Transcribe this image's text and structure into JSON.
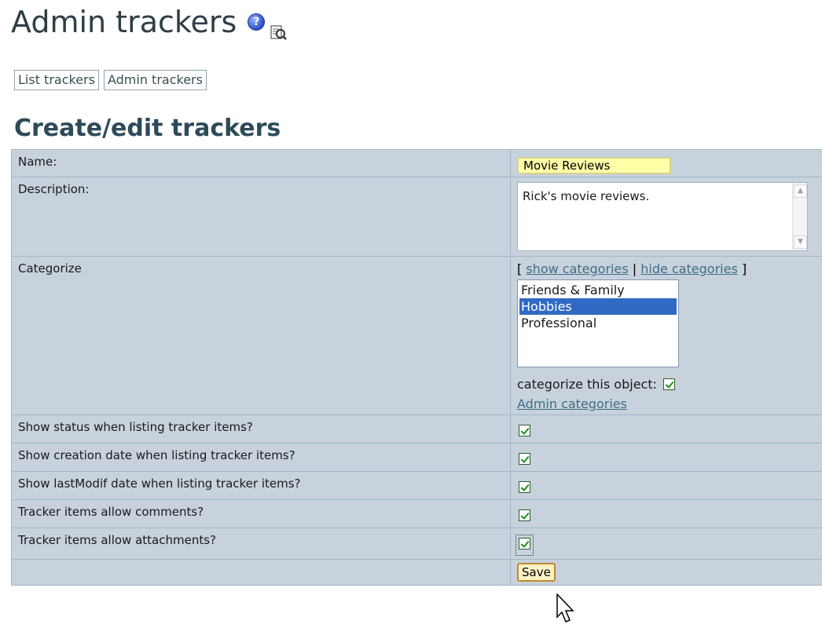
{
  "page": {
    "title": "Admin trackers",
    "help_icon": "help-icon",
    "edit_icon": "edit-icon"
  },
  "nav": {
    "buttons": [
      "List trackers",
      "Admin trackers"
    ]
  },
  "form": {
    "section_title": "Create/edit trackers",
    "name_label": "Name:",
    "name_value": "Movie Reviews",
    "description_label": "Description:",
    "description_value": "Rick's movie reviews.",
    "categorize_label": "Categorize",
    "cat_links": {
      "open_bracket": "[",
      "show": "show categories",
      "separator": "|",
      "hide": "hide categories",
      "close_bracket": "]"
    },
    "categories": [
      "Friends & Family",
      "Hobbies",
      "Professional"
    ],
    "selected_category": "Hobbies",
    "categorize_object_label": "categorize this object:",
    "admin_categories_link": "Admin categories",
    "options": [
      {
        "label": "Show status when listing tracker items?",
        "checked": true
      },
      {
        "label": "Show creation date when listing tracker items?",
        "checked": true
      },
      {
        "label": "Show lastModif date when listing tracker items?",
        "checked": true
      },
      {
        "label": "Tracker items allow comments?",
        "checked": true
      },
      {
        "label": "Tracker items allow attachments?",
        "checked": true
      }
    ],
    "save_label": "Save"
  },
  "colors": {
    "table_bg": "#c8d2dc",
    "selection": "#316ac5",
    "link": "#3e6f87",
    "input_highlight": "#ffffa8"
  }
}
